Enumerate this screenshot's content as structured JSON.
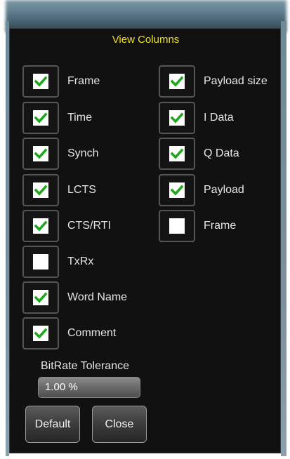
{
  "dialog": {
    "title": "View Columns"
  },
  "left_column": [
    {
      "label": "Frame",
      "checked": true
    },
    {
      "label": "Time",
      "checked": true
    },
    {
      "label": "Synch",
      "checked": true
    },
    {
      "label": "LCTS",
      "checked": true
    },
    {
      "label": "CTS/RTI",
      "checked": true
    },
    {
      "label": "TxRx",
      "checked": false
    },
    {
      "label": "Word Name",
      "checked": true
    },
    {
      "label": "Comment",
      "checked": true
    }
  ],
  "right_column": [
    {
      "label": "Payload size",
      "checked": true
    },
    {
      "label": "I Data",
      "checked": true
    },
    {
      "label": "Q Data",
      "checked": true
    },
    {
      "label": "Payload",
      "checked": true
    },
    {
      "label": "Frame",
      "checked": false
    }
  ],
  "tolerance": {
    "label": "BitRate Tolerance",
    "value": "1.00 %"
  },
  "buttons": {
    "default_label": "Default",
    "close_label": "Close"
  },
  "colors": {
    "title": "#f0e020",
    "check": "#1fa81f",
    "background": "#111111"
  }
}
